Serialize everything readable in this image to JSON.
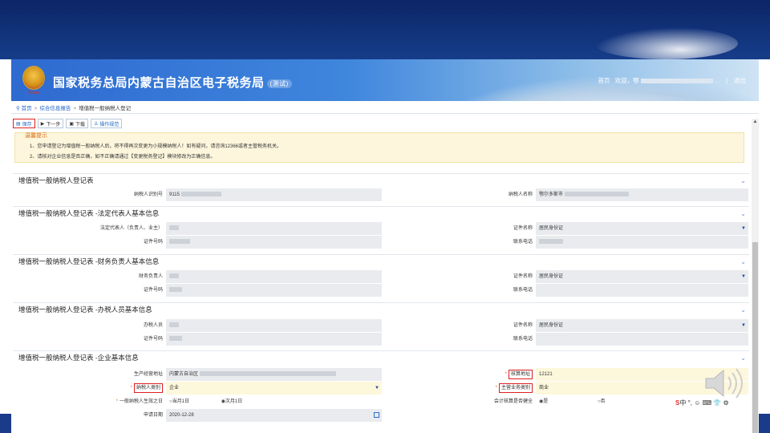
{
  "header": {
    "emblem_caption": "Taxes",
    "title": "国家税务总局内蒙古自治区电子税务局",
    "title_suffix": "(测试)",
    "home_link": "首页",
    "welcome": "欢迎，鄂",
    "logout": "退出"
  },
  "breadcrumb": {
    "home": "首页",
    "reports": "综合信息报告",
    "current": "增值税一般纳税人登记"
  },
  "toolbar": {
    "save": "保存",
    "next": "下一步",
    "download": "下载",
    "guide": "操作规范"
  },
  "notice": {
    "title": "温馨提示",
    "line1": "1、您申请登记为增值税一般纳税人后，将不得再次变更为小规模纳税人！如有疑问，请咨询12366或者主管税务机关。",
    "line2": "2、请核对企业信息是否正确，如不正确请通过【变更税务登记】模块修改为正确信息。"
  },
  "sections": {
    "s1": {
      "title": "增值税一般纳税人登记表",
      "taxpayer_id_label": "纳税人识别号",
      "taxpayer_id_value": "9115",
      "taxpayer_name_label": "纳税人名称",
      "taxpayer_name_value": "鄂尔多斯市"
    },
    "s2": {
      "title": "增值税一般纳税人登记表 -法定代表人基本信息",
      "rep_label": "法定代表人（负责人、业主）",
      "cert_name_label": "证件名称",
      "cert_name_value": "居民身份证",
      "cert_no_label": "证件号码",
      "phone_label": "联系电话"
    },
    "s3": {
      "title": "增值税一般纳税人登记表 -财务负责人基本信息",
      "person_label": "财务负责人",
      "cert_name_label": "证件名称",
      "cert_name_value": "居民身份证",
      "cert_no_label": "证件号码",
      "phone_label": "联系电话"
    },
    "s4": {
      "title": "增值税一般纳税人登记表 -办税人员基本信息",
      "person_label": "办税人员",
      "cert_name_label": "证件名称",
      "cert_name_value": "居民身份证",
      "cert_no_label": "证件号码",
      "phone_label": "联系电话"
    },
    "s5": {
      "title": "增值税一般纳税人登记表 -企业基本信息",
      "address_label": "生产经营地址",
      "address_value": "内蒙古自治区",
      "calc_addr_label": "核算地址",
      "calc_addr_value": "12121",
      "type_label": "纳税人类别",
      "type_value": "企业",
      "business_label": "主营业务类别",
      "business_value": "商业",
      "effective_label": "一般纳税人生效之日",
      "effective_opt1": "当月1日",
      "effective_opt2": "次月1日",
      "accounting_label": "会计核算是否健全",
      "accounting_yes": "是",
      "accounting_no": "否",
      "apply_date_label": "申请日期",
      "apply_date_value": "2020-12-28"
    }
  },
  "ime": {
    "text": "中 °, ☺ ⌨ 👕 ⚙"
  }
}
